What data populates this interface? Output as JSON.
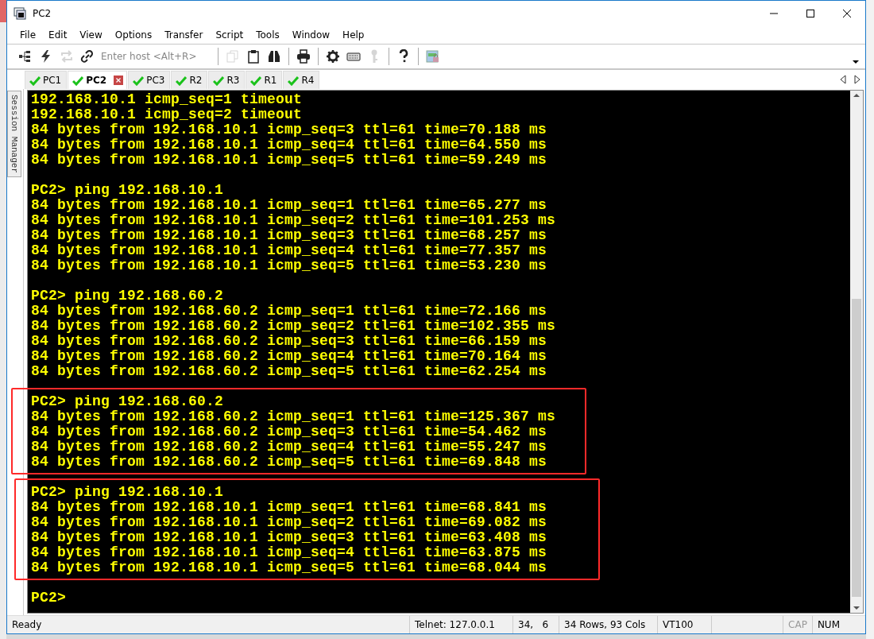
{
  "window": {
    "title": "PC2"
  },
  "menu": [
    {
      "label": "File"
    },
    {
      "label": "Edit"
    },
    {
      "label": "View"
    },
    {
      "label": "Options"
    },
    {
      "label": "Transfer"
    },
    {
      "label": "Script"
    },
    {
      "label": "Tools"
    },
    {
      "label": "Window"
    },
    {
      "label": "Help"
    }
  ],
  "toolbar": {
    "items": [
      {
        "kind": "tree",
        "disabled": false
      },
      {
        "kind": "bolt",
        "disabled": false
      },
      {
        "kind": "cycle",
        "disabled": true
      },
      {
        "kind": "chain",
        "disabled": false
      },
      {
        "kind": "host"
      },
      {
        "kind": "sep"
      },
      {
        "kind": "copy",
        "disabled": true
      },
      {
        "kind": "clipboard",
        "disabled": false
      },
      {
        "kind": "binoculars",
        "disabled": false
      },
      {
        "kind": "sep"
      },
      {
        "kind": "printer",
        "disabled": false
      },
      {
        "kind": "sep"
      },
      {
        "kind": "gear",
        "disabled": false
      },
      {
        "kind": "keyboard",
        "disabled": false
      },
      {
        "kind": "key",
        "disabled": true
      },
      {
        "kind": "sep"
      },
      {
        "kind": "help",
        "disabled": false
      },
      {
        "kind": "sep"
      },
      {
        "kind": "lock",
        "disabled": false
      }
    ],
    "host_placeholder": "Enter host <Alt+R>"
  },
  "tabs": [
    {
      "label": "PC1",
      "selected": false
    },
    {
      "label": "PC2",
      "selected": true
    },
    {
      "label": "PC3",
      "selected": false
    },
    {
      "label": "R2",
      "selected": false
    },
    {
      "label": "R3",
      "selected": false
    },
    {
      "label": "R1",
      "selected": false
    },
    {
      "label": "R4",
      "selected": false
    }
  ],
  "session_manager": {
    "label": "Session Manager"
  },
  "terminal": {
    "blocks": [
      {
        "highlighted": false,
        "lines": [
          "192.168.10.1 icmp_seq=1 timeout",
          "192.168.10.1 icmp_seq=2 timeout",
          "84 bytes from 192.168.10.1 icmp_seq=3 ttl=61 time=70.188 ms",
          "84 bytes from 192.168.10.1 icmp_seq=4 ttl=61 time=64.550 ms",
          "84 bytes from 192.168.10.1 icmp_seq=5 ttl=61 time=59.249 ms"
        ]
      },
      {
        "highlighted": false,
        "lines": [
          "PC2> ping 192.168.10.1",
          "84 bytes from 192.168.10.1 icmp_seq=1 ttl=61 time=65.277 ms",
          "84 bytes from 192.168.10.1 icmp_seq=2 ttl=61 time=101.253 ms",
          "84 bytes from 192.168.10.1 icmp_seq=3 ttl=61 time=68.257 ms",
          "84 bytes from 192.168.10.1 icmp_seq=4 ttl=61 time=77.357 ms",
          "84 bytes from 192.168.10.1 icmp_seq=5 ttl=61 time=53.230 ms"
        ]
      },
      {
        "highlighted": false,
        "lines": [
          "PC2> ping 192.168.60.2",
          "84 bytes from 192.168.60.2 icmp_seq=1 ttl=61 time=72.166 ms",
          "84 bytes from 192.168.60.2 icmp_seq=2 ttl=61 time=102.355 ms",
          "84 bytes from 192.168.60.2 icmp_seq=3 ttl=61 time=66.159 ms",
          "84 bytes from 192.168.60.2 icmp_seq=4 ttl=61 time=70.164 ms",
          "84 bytes from 192.168.60.2 icmp_seq=5 ttl=61 time=62.254 ms"
        ]
      },
      {
        "highlighted": true,
        "lines": [
          "PC2> ping 192.168.60.2",
          "84 bytes from 192.168.60.2 icmp_seq=1 ttl=61 time=125.367 ms",
          "84 bytes from 192.168.60.2 icmp_seq=3 ttl=61 time=54.462 ms",
          "84 bytes from 192.168.60.2 icmp_seq=4 ttl=61 time=55.247 ms",
          "84 bytes from 192.168.60.2 icmp_seq=5 ttl=61 time=69.848 ms"
        ]
      },
      {
        "highlighted": true,
        "lines": [
          "PC2> ping 192.168.10.1",
          "84 bytes from 192.168.10.1 icmp_seq=1 ttl=61 time=68.841 ms",
          "84 bytes from 192.168.10.1 icmp_seq=2 ttl=61 time=69.082 ms",
          "84 bytes from 192.168.10.1 icmp_seq=3 ttl=61 time=63.408 ms",
          "84 bytes from 192.168.10.1 icmp_seq=4 ttl=61 time=63.875 ms",
          "84 bytes from 192.168.10.1 icmp_seq=5 ttl=61 time=68.044 ms"
        ]
      },
      {
        "highlighted": false,
        "lines": [
          "PC2>"
        ]
      }
    ]
  },
  "status_bar": [
    {
      "text": "Ready",
      "disabled": false
    },
    {
      "text": "Telnet: 127.0.0.1",
      "disabled": false
    },
    {
      "text": "34,   6",
      "disabled": false
    },
    {
      "text": "34 Rows, 93 Cols",
      "disabled": false
    },
    {
      "text": "VT100",
      "disabled": false
    },
    {
      "text": "CAP",
      "disabled": true
    },
    {
      "text": "NUM",
      "disabled": false
    }
  ]
}
